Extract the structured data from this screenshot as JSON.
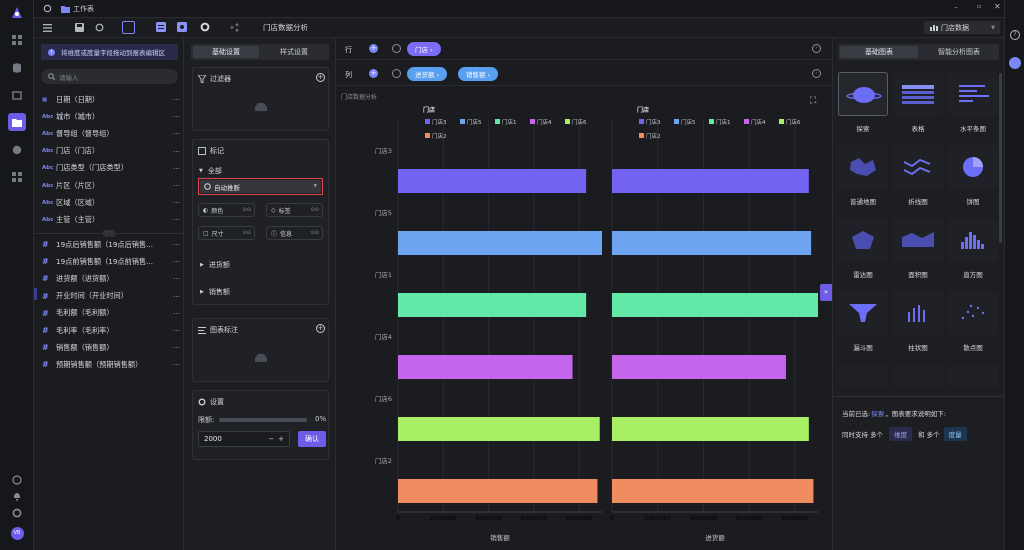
{
  "topbar": {
    "workspace": "工作表"
  },
  "toolbar": {
    "dataset_tab": "门店数据分析",
    "dataset_select": "门店数据"
  },
  "fields_panel": {
    "banner": "将维度或度量字段拖动到报表编辑区",
    "search_placeholder": "请输入",
    "dimensions": [
      {
        "type": "date",
        "label": "日期（日期）"
      },
      {
        "type": "Abc",
        "label": "城市（城市）"
      },
      {
        "type": "Abc",
        "label": "督导组（督导组）"
      },
      {
        "type": "Abc",
        "label": "门店（门店）"
      },
      {
        "type": "Abc",
        "label": "门店类型（门店类型）"
      },
      {
        "type": "Abc",
        "label": "片区（片区）"
      },
      {
        "type": "Abc",
        "label": "区域（区域）"
      },
      {
        "type": "Abc",
        "label": "主管（主管）"
      }
    ],
    "measures": [
      {
        "label": "19点后销售额（19点后销售..."
      },
      {
        "label": "19点前销售额（19点前销售..."
      },
      {
        "label": "进货额（进货额）"
      },
      {
        "label": "开业时间（开业时间）"
      },
      {
        "label": "毛利额（毛利额）"
      },
      {
        "label": "毛利率（毛利率）"
      },
      {
        "label": "销售额（销售额）"
      },
      {
        "label": "预期销售额（预期销售额）"
      }
    ]
  },
  "config": {
    "tabs": [
      "基础设置",
      "样式设置"
    ],
    "filter_title": "过滤器",
    "marks_title": "标记",
    "all_label": "全部",
    "auto_infer": "自动推断",
    "mark_buttons": [
      "颜色",
      "标签",
      "尺寸",
      "信息"
    ],
    "measure_groups": [
      "进货额",
      "销售额"
    ],
    "annotation_title": "图表标注",
    "settings_title": "设置",
    "limit_label": "限额:",
    "limit_percent": "0%",
    "limit_percent_value": 0,
    "limit_value": "2000",
    "confirm_label": "确认"
  },
  "shelves": {
    "row_label": "行",
    "col_label": "列",
    "row_pills": [
      {
        "label": "门店 ›",
        "color": "#7b6cf6"
      }
    ],
    "col_pills": [
      {
        "label": "进货额 ›",
        "color": "#5aa0f0"
      },
      {
        "label": "销售额 ›",
        "color": "#5aa0f0"
      }
    ]
  },
  "chart_title": "门店数据分析",
  "chart_data": {
    "type": "bar",
    "orientation": "horizontal",
    "categories": [
      "门店3",
      "门店5",
      "门店1",
      "门店4",
      "门店6",
      "门店2"
    ],
    "colors": [
      "#7264f0",
      "#6ca4f2",
      "#62e9a8",
      "#c565ec",
      "#a9ef63",
      "#ef8d60"
    ],
    "legend_title": "门店",
    "legend": [
      "门店3",
      "门店5",
      "门店1",
      "门店4",
      "门店6",
      "门店2"
    ],
    "xlim": [
      0,
      9000000
    ],
    "xticks": [
      "0",
      "2000000",
      "4000000",
      "6000000",
      "8000000"
    ],
    "panels": [
      {
        "xlabel": "销售额",
        "values": [
          8300000,
          9000000,
          8300000,
          7700000,
          8900000,
          8800000
        ]
      },
      {
        "xlabel": "进货额",
        "values": [
          8600000,
          8700000,
          9400000,
          7600000,
          8600000,
          8800000
        ]
      }
    ]
  },
  "right_panel": {
    "tabs": [
      "基础图表",
      "智能分析图表"
    ],
    "charts": [
      "探索",
      "表格",
      "水平条图",
      "普通地图",
      "折线图",
      "饼图",
      "雷达图",
      "面积图",
      "直方图",
      "漏斗图",
      "柱状图",
      "散点图"
    ],
    "selected_prefix": "当前已选:",
    "selected_name": "探索",
    "selected_suffix": "，图表要求说明如下:",
    "req_prefix": "同时支持 多个",
    "req_dim": "维度",
    "req_mid": "和 多个",
    "req_measure": "度量"
  },
  "user": {
    "initials": "VB"
  },
  "colors": {
    "accent": "#6c5ce7",
    "highlight_border": "#e0474c"
  }
}
